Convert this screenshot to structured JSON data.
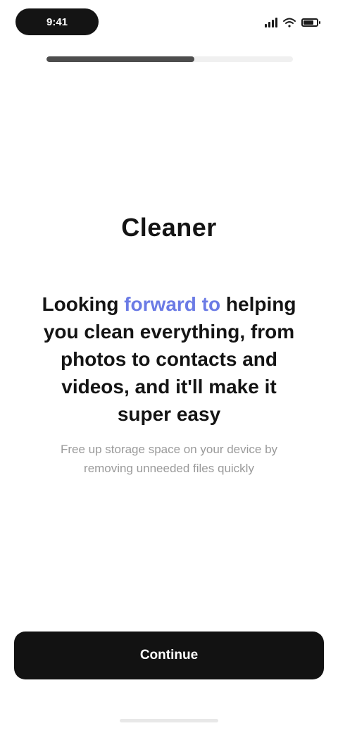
{
  "status_bar": {
    "time": "9:41",
    "battery_level": 0.8
  },
  "onboarding": {
    "progress": 0.6,
    "brand": "Cleaner",
    "headline_pre": "Looking ",
    "headline_accent": "forward to",
    "headline_post": " helping you clean everything, from photos to contacts and videos, and it'll make it super easy",
    "subtext": "Free up storage space on your device by removing unneeded files quickly",
    "continue_label": "Continue"
  },
  "colors": {
    "accent": "#6b7be5",
    "button": "#121212",
    "progress": "#4d4d4d"
  }
}
